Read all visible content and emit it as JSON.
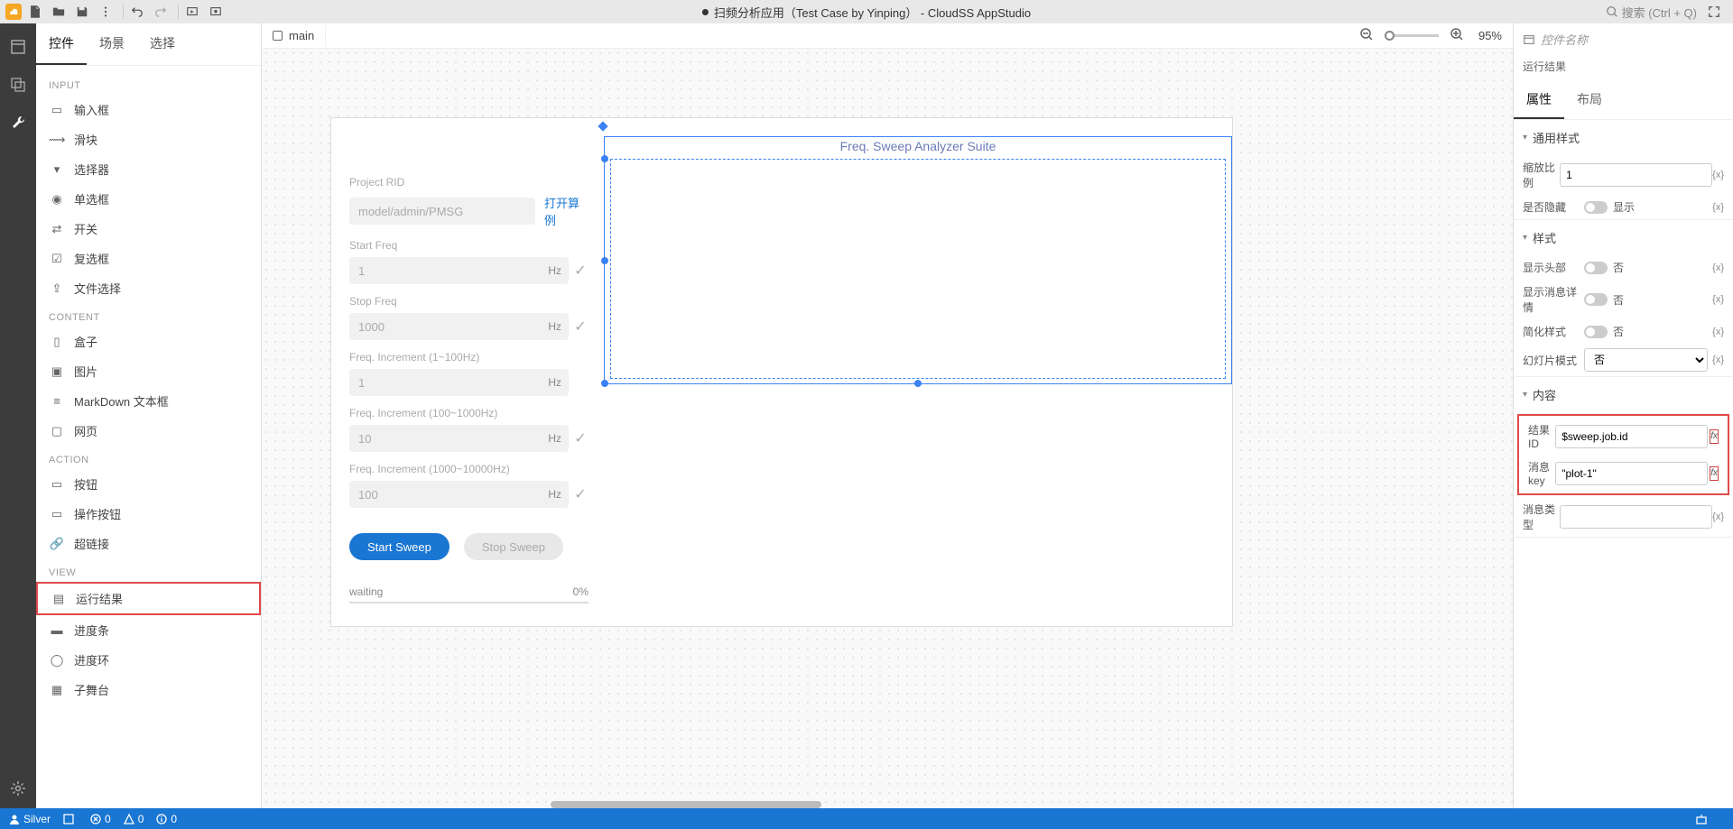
{
  "app_title": "扫频分析应用（Test Case by Yinping） - CloudSS AppStudio",
  "search_placeholder": "搜索 (Ctrl + Q)",
  "left_tabs": {
    "widgets": "控件",
    "scenes": "场景",
    "select": "选择"
  },
  "canvas_tab": "main",
  "zoom_level": "95%",
  "widget_groups": {
    "input_header": "INPUT",
    "input_items": [
      "输入框",
      "滑块",
      "选择器",
      "单选框",
      "开关",
      "复选框",
      "文件选择"
    ],
    "content_header": "CONTENT",
    "content_items": [
      "盒子",
      "图片",
      "MarkDown 文本框",
      "网页"
    ],
    "action_header": "ACTION",
    "action_items": [
      "按钮",
      "操作按钮",
      "超链接"
    ],
    "view_header": "VIEW",
    "view_items": [
      "运行结果",
      "进度条",
      "进度环",
      "子舞台"
    ]
  },
  "stage": {
    "selected_title": "Freq. Sweep Analyzer Suite",
    "project_rid_label": "Project RID",
    "project_rid_value": "model/admin/PMSG",
    "open_case": "打开算例",
    "start_freq_label": "Start Freq",
    "start_freq_value": "1",
    "stop_freq_label": "Stop Freq",
    "stop_freq_value": "1000",
    "inc1_label": "Freq. Increment (1~100Hz)",
    "inc1_value": "1",
    "inc2_label": "Freq. Increment (100~1000Hz)",
    "inc2_value": "10",
    "inc3_label": "Freq. Increment (1000~10000Hz)",
    "inc3_value": "100",
    "hz_unit": "Hz",
    "start_sweep": "Start Sweep",
    "stop_sweep": "Stop Sweep",
    "waiting": "waiting",
    "percent": "0%"
  },
  "right": {
    "name_placeholder": "控件名称",
    "subtitle": "运行结果",
    "tabs": {
      "attr": "属性",
      "layout": "布局"
    },
    "sec_general": "通用样式",
    "scale_label": "缩放比例",
    "scale_value": "1",
    "hidden_label": "是否隐藏",
    "hidden_value": "显示",
    "sec_style": "样式",
    "show_header_label": "显示头部",
    "show_header_value": "否",
    "show_msg_label": "显示消息详情",
    "show_msg_value": "否",
    "simple_label": "简化样式",
    "simple_value": "否",
    "slide_label": "幻灯片模式",
    "slide_value": "否",
    "sec_content": "内容",
    "result_id_label": "结果 ID",
    "result_id_value": "$sweep.job.id",
    "msg_key_label": "消息 key",
    "msg_key_value": "\"plot-1\"",
    "msg_type_label": "消息类型",
    "msg_type_value": ""
  },
  "status": {
    "user": "Silver",
    "err": "0",
    "warn": "0",
    "info": "0"
  }
}
